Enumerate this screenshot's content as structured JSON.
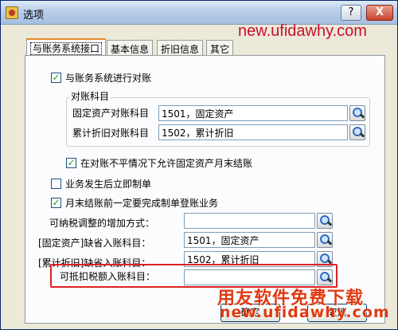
{
  "window": {
    "title": "选项",
    "help_label": "?",
    "close_label": "X"
  },
  "watermarks": {
    "top_url": "new.ufidawhy.com",
    "bottom_cn": "用友软件免费下载",
    "bottom_url": "new.ufidawhy.com"
  },
  "tabs": [
    {
      "label": "与账务系统接口",
      "active": true
    },
    {
      "label": "基本信息",
      "active": false
    },
    {
      "label": "折旧信息",
      "active": false
    },
    {
      "label": "其它",
      "active": false
    }
  ],
  "panel": {
    "link_checkbox": {
      "label": "与账务系统进行对账",
      "checked": true
    },
    "group": {
      "legend": "对账科目",
      "rows": [
        {
          "label": "固定资产对账科目",
          "value": "1501，固定资产"
        },
        {
          "label": "累计折旧对账科目",
          "value": "1502，累计折旧"
        }
      ]
    },
    "allow_close_checkbox": {
      "label": "在对账不平情况下允许固定资产月末结账",
      "checked": true
    },
    "post_entry_checkbox": {
      "label": "业务发生后立即制单",
      "checked": false
    },
    "month_end_checkbox": {
      "label": "月末结账前一定要完成制单登账业务",
      "checked": true
    },
    "fields": [
      {
        "label": "可纳税调整的增加方式：",
        "value": ""
      },
      {
        "label": "[固定资产]缺省入账科目：",
        "value": "1501，固定资产"
      },
      {
        "label": "[累计折旧]缺省入账科目：",
        "value": "1502，累计折旧"
      },
      {
        "label": "可抵扣税额入账科目：",
        "value": ""
      }
    ]
  },
  "buttons": {
    "ok": "确定",
    "cancel": "取消"
  },
  "colors": {
    "highlight": "#dd2222",
    "watermark": "#e03a12",
    "tab_accent": "#e68b2c"
  }
}
